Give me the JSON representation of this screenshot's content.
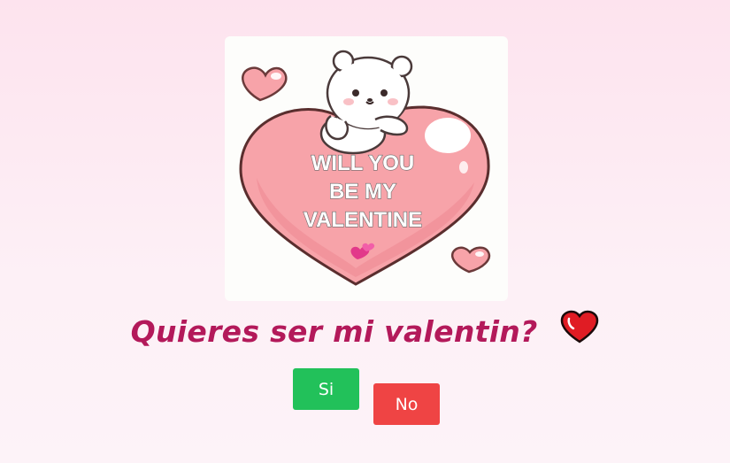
{
  "gif": {
    "text_line1": "WILL YOU",
    "text_line2": "BE MY",
    "text_line3": "VALENTINE",
    "character": "white-bear-on-heart"
  },
  "question": {
    "text": "Quieres ser mi valentin?",
    "icon": "red-heart-icon"
  },
  "buttons": {
    "yes_label": "Si",
    "no_label": "No"
  },
  "colors": {
    "background": "#fde3ee",
    "question_text": "#b3195a",
    "yes_button": "#22c15a",
    "no_button": "#ef4444",
    "big_heart": "#f7a3a9"
  }
}
